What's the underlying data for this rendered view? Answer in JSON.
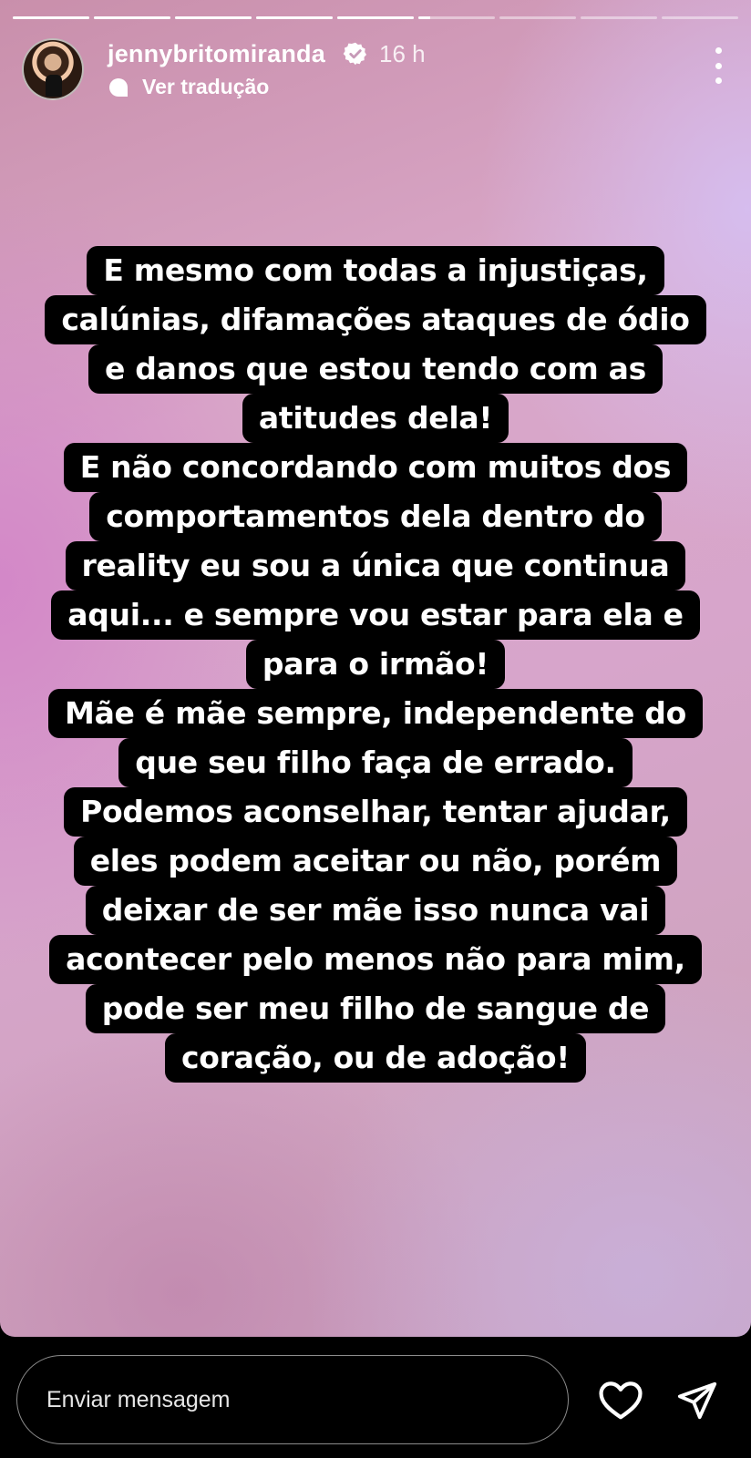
{
  "story": {
    "segments_total": 9,
    "segments_complete": 5,
    "current_segment_progress": 0.15
  },
  "header": {
    "username": "jennybritomiranda",
    "time": "16 h",
    "translate_label": "Ver tradução",
    "verified": true
  },
  "story_text_lines": [
    "E mesmo com todas a injustiças,",
    "calúnias, difamações ataques de ódio",
    "e danos que estou tendo com as",
    "atitudes dela!",
    "E não concordando com muitos dos",
    "comportamentos dela dentro do",
    "reality eu sou a única que continua",
    "aqui... e sempre vou estar para ela e",
    "para o irmão!",
    "Mãe é mãe sempre, independente do",
    "que seu filho faça de errado.",
    "Podemos aconselhar, tentar ajudar,",
    "eles podem aceitar ou não, porém",
    "deixar de ser mãe isso nunca vai",
    "acontecer pelo menos não para mim,",
    "pode ser meu filho de sangue de",
    "coração, ou de adoção!"
  ],
  "footer": {
    "message_placeholder": "Enviar mensagem",
    "like_icon": "heart-icon",
    "send_icon": "paper-plane-icon"
  },
  "colors": {
    "text_bg": "#000000",
    "text_fg": "#ffffff",
    "background_pink": "#d9a7c8",
    "background_lavender": "#d6bef0"
  }
}
